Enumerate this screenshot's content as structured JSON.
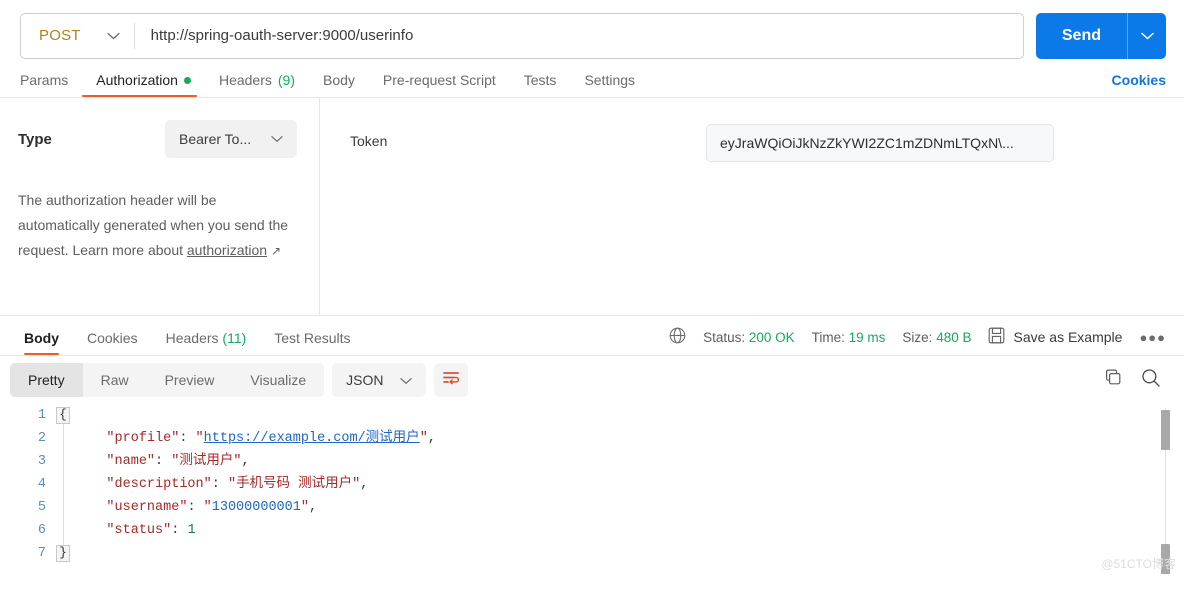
{
  "request": {
    "method": "POST",
    "url": "http://spring-oauth-server:9000/userinfo",
    "send_label": "Send",
    "tabs": [
      {
        "label": "Params",
        "active": false,
        "dot": false,
        "count": ""
      },
      {
        "label": "Authorization",
        "active": true,
        "dot": true,
        "count": ""
      },
      {
        "label": "Headers",
        "active": false,
        "dot": false,
        "count": "(9)"
      },
      {
        "label": "Body",
        "active": false,
        "dot": false,
        "count": ""
      },
      {
        "label": "Pre-request Script",
        "active": false,
        "dot": false,
        "count": ""
      },
      {
        "label": "Tests",
        "active": false,
        "dot": false,
        "count": ""
      },
      {
        "label": "Settings",
        "active": false,
        "dot": false,
        "count": ""
      }
    ],
    "cookies_label": "Cookies"
  },
  "authorization": {
    "type_label": "Type",
    "type_value": "Bearer To...",
    "help_text_1": "The authorization header will be automatically generated when you send the request. Learn more about ",
    "help_link": "authorization",
    "help_arrow": "↗",
    "token_label": "Token",
    "token_value": "eyJraWQiOiJkNzZkYWI2ZC1mZDNmLTQxN\\..."
  },
  "response": {
    "tabs": [
      {
        "label": "Body",
        "active": true,
        "count": ""
      },
      {
        "label": "Cookies",
        "active": false,
        "count": ""
      },
      {
        "label": "Headers",
        "active": false,
        "count": "(11)"
      },
      {
        "label": "Test Results",
        "active": false,
        "count": ""
      }
    ],
    "status_label": "Status:",
    "status_value": "200 OK",
    "time_label": "Time:",
    "time_value": "19 ms",
    "size_label": "Size:",
    "size_value": "480 B",
    "save_example_label": "Save as Example",
    "format_tabs": [
      {
        "label": "Pretty",
        "active": true
      },
      {
        "label": "Raw",
        "active": false
      },
      {
        "label": "Preview",
        "active": false
      },
      {
        "label": "Visualize",
        "active": false
      }
    ],
    "language": "JSON",
    "watermark": "@51CTO博客"
  },
  "body_json": {
    "lines": [
      {
        "n": "1",
        "indent": 0,
        "type": "brace_open",
        "text": "{"
      },
      {
        "n": "2",
        "indent": 4,
        "type": "link",
        "key": "profile",
        "value": "https://example.com/测试用户",
        "comma": true
      },
      {
        "n": "3",
        "indent": 4,
        "type": "string",
        "key": "name",
        "value": "测试用户",
        "comma": true
      },
      {
        "n": "4",
        "indent": 4,
        "type": "string",
        "key": "description",
        "value": "手机号码 测试用户",
        "comma": true
      },
      {
        "n": "5",
        "indent": 4,
        "type": "numstr",
        "key": "username",
        "value": "13000000001",
        "comma": true
      },
      {
        "n": "6",
        "indent": 4,
        "type": "number",
        "key": "status",
        "value": "1",
        "comma": false
      },
      {
        "n": "7",
        "indent": 0,
        "type": "brace_close",
        "text": "}"
      }
    ]
  },
  "colors": {
    "accent_orange": "#ef5b25",
    "send_blue": "#0b79e8",
    "method_amber": "#b5801b",
    "success_green": "#13ab5c",
    "link_blue": "#1274e0"
  },
  "icons": {
    "chevron_down": "chevron-down-icon",
    "globe": "globe-icon",
    "save": "save-icon",
    "copy": "copy-icon",
    "search": "search-icon",
    "wrap": "wrap-text-icon",
    "more": "more-options-icon"
  }
}
